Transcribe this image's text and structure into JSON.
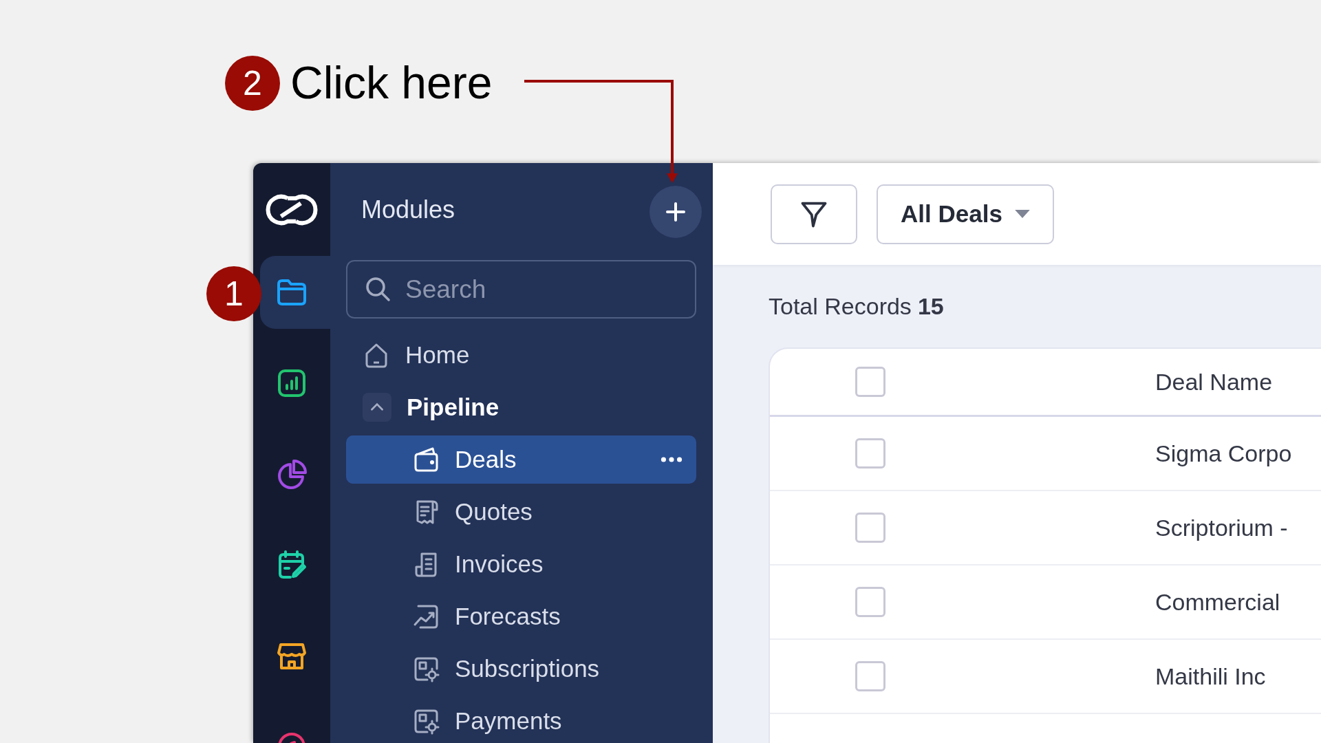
{
  "annotations": [
    {
      "number": "2",
      "text": "Click here"
    },
    {
      "number": "1"
    }
  ],
  "rail": [
    {
      "kind": "folder",
      "color": "#1aa3ff",
      "selected": true
    },
    {
      "kind": "chart",
      "color": "#22c46e",
      "selected": false
    },
    {
      "kind": "pie",
      "color": "#a24be6",
      "selected": false
    },
    {
      "kind": "calendar",
      "color": "#1ed1a8",
      "selected": false
    },
    {
      "kind": "store",
      "color": "#f5a524",
      "selected": false
    },
    {
      "kind": "gauge",
      "color": "#e8336d",
      "selected": false
    }
  ],
  "modules": {
    "title": "Modules",
    "search": {
      "placeholder": "Search"
    },
    "items": [
      {
        "label": "Home",
        "kind": "home"
      },
      {
        "label": "Pipeline",
        "kind": "group",
        "expanded": true,
        "children": [
          {
            "label": "Deals",
            "kind": "wallet",
            "selected": true
          },
          {
            "label": "Quotes",
            "kind": "receipt",
            "selected": false
          },
          {
            "label": "Invoices",
            "kind": "invoice",
            "selected": false
          },
          {
            "label": "Forecasts",
            "kind": "trend",
            "selected": false
          },
          {
            "label": "Subscriptions",
            "kind": "gearbox",
            "selected": false
          },
          {
            "label": "Payments",
            "kind": "gearbox",
            "selected": false
          }
        ]
      }
    ]
  },
  "toolbar": {
    "view": "All Deals"
  },
  "total": {
    "label": "Total Records",
    "count": "15"
  },
  "table": {
    "header_checked": false,
    "columns": [
      "Deal Name"
    ],
    "rows": [
      {
        "checked": false,
        "deal_name": "Sigma Corpo"
      },
      {
        "checked": false,
        "deal_name": "Scriptorium -"
      },
      {
        "checked": false,
        "deal_name": "Commercial"
      },
      {
        "checked": false,
        "deal_name": "Maithili Inc"
      }
    ]
  }
}
